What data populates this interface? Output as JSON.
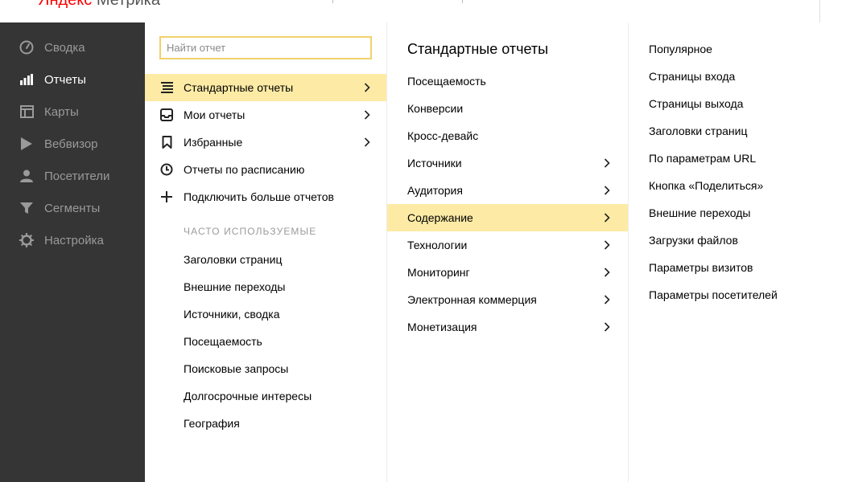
{
  "header": {
    "brand": "Яндекс",
    "product": "Метрика"
  },
  "nav": {
    "items": [
      {
        "label": "Сводка",
        "icon": "gauge-icon",
        "active": false
      },
      {
        "label": "Отчеты",
        "icon": "bar-chart-icon",
        "active": true
      },
      {
        "label": "Карты",
        "icon": "map-layout-icon",
        "active": false
      },
      {
        "label": "Вебвизор",
        "icon": "play-icon",
        "active": false
      },
      {
        "label": "Посетители",
        "icon": "user-icon",
        "active": false
      },
      {
        "label": "Сегменты",
        "icon": "funnel-icon",
        "active": false
      },
      {
        "label": "Настройка",
        "icon": "gear-icon",
        "active": false
      }
    ]
  },
  "reports": {
    "search_placeholder": "Найти отчет",
    "menu": [
      {
        "label": "Стандартные отчеты",
        "icon": "list-icon",
        "has_submenu": true,
        "selected": true
      },
      {
        "label": "Мои отчеты",
        "icon": "inbox-icon",
        "has_submenu": true,
        "selected": false
      },
      {
        "label": "Избранные",
        "icon": "bookmark-icon",
        "has_submenu": true,
        "selected": false
      },
      {
        "label": "Отчеты по расписанию",
        "icon": "clock-icon",
        "has_submenu": false,
        "selected": false
      },
      {
        "label": "Подключить больше отчетов",
        "icon": "plus-icon",
        "has_submenu": false,
        "selected": false
      }
    ],
    "frequent_title": "ЧАСТО ИСПОЛЬЗУЕМЫЕ",
    "frequent": [
      "Заголовки страниц",
      "Внешние переходы",
      "Источники, сводка",
      "Посещаемость",
      "Поисковые запросы",
      "Долгосрочные интересы",
      "География"
    ]
  },
  "standard": {
    "title": "Стандартные отчеты",
    "items": [
      {
        "label": "Посещаемость",
        "has_submenu": false,
        "selected": false
      },
      {
        "label": "Конверсии",
        "has_submenu": false,
        "selected": false
      },
      {
        "label": "Кросс-девайс",
        "has_submenu": false,
        "selected": false
      },
      {
        "label": "Источники",
        "has_submenu": true,
        "selected": false
      },
      {
        "label": "Аудитория",
        "has_submenu": true,
        "selected": false
      },
      {
        "label": "Содержание",
        "has_submenu": true,
        "selected": true
      },
      {
        "label": "Технологии",
        "has_submenu": true,
        "selected": false
      },
      {
        "label": "Мониторинг",
        "has_submenu": true,
        "selected": false
      },
      {
        "label": "Электронная коммерция",
        "has_submenu": true,
        "selected": false
      },
      {
        "label": "Монетизация",
        "has_submenu": true,
        "selected": false
      }
    ]
  },
  "content": {
    "items": [
      "Популярное",
      "Страницы входа",
      "Страницы выхода",
      "Заголовки страниц",
      "По параметрам URL",
      "Кнопка «Поделиться»",
      "Внешние переходы",
      "Загрузки файлов",
      "Параметры визитов",
      "Параметры посетителей"
    ]
  },
  "colors": {
    "nav_bg": "#353535",
    "selected_bg": "#fdeba5",
    "search_border": "#f0d26a",
    "brand_red": "#ff0000"
  }
}
